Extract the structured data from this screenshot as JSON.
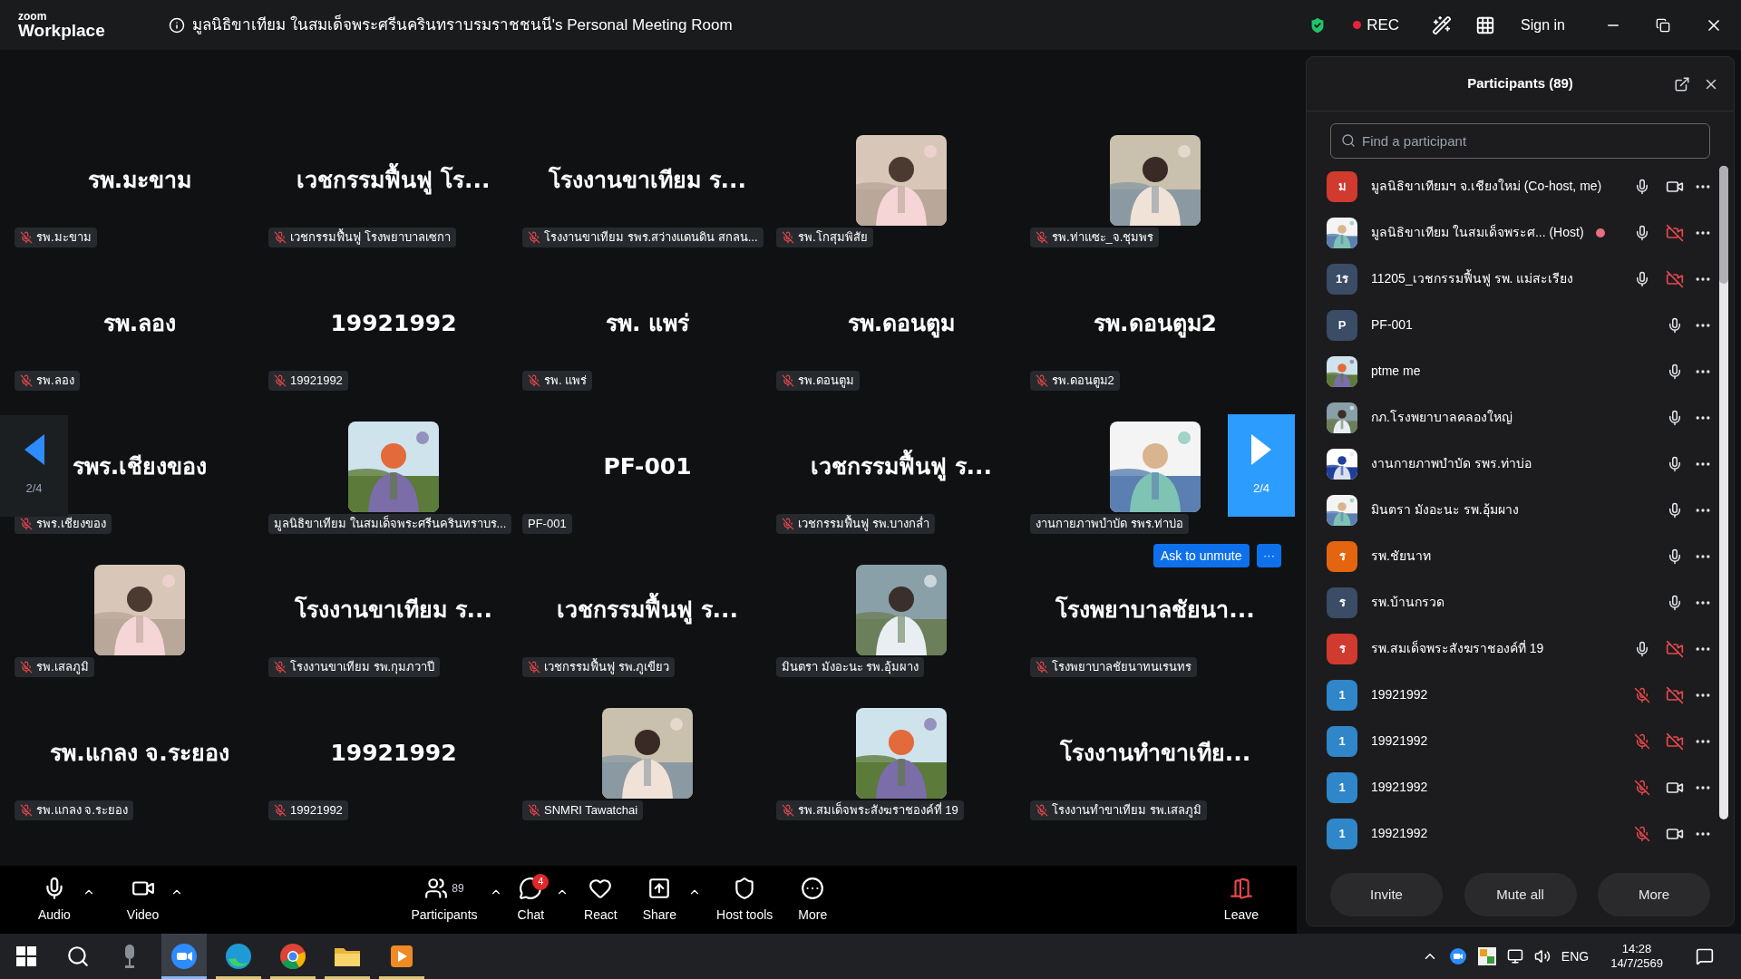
{
  "app": {
    "logo_top": "zoom",
    "logo_bottom": "Workplace"
  },
  "window": {
    "title": "มูลนิธิขาเทียม ในสมเด็จพระศรีนครินทราบรมราชชนนี's Personal Meeting Room",
    "recording": true,
    "rec_label": "REC",
    "sign_in": "Sign in"
  },
  "gallery": {
    "prev_page": "2/4",
    "next_page": "2/4",
    "ask_to_unmute": "Ask to unmute",
    "ask_more": "···",
    "tiles": [
      {
        "kind": "name",
        "display": "รพ.มะขาม",
        "label": "รพ.มะขาม",
        "muted": true
      },
      {
        "kind": "name",
        "display": "เวชกรรมฟื้นฟู โร...",
        "label": "เวชกรรมฟื้นฟู โรงพยาบาลเซกา",
        "muted": true
      },
      {
        "kind": "name",
        "display": "โรงงานขาเทียม ร...",
        "label": "โรงงานขาเทียม รพร.สว่างแดนดิน สกลน...",
        "muted": true
      },
      {
        "kind": "picture",
        "label": "รพ.โกสุมพิสัย",
        "muted": true
      },
      {
        "kind": "picture",
        "label": "รพ.ท่าแซะ_จ.ชุมพร",
        "muted": true
      },
      {
        "kind": "name",
        "display": "รพ.ลอง",
        "label": "รพ.ลอง",
        "muted": true
      },
      {
        "kind": "name",
        "display": "19921992",
        "label": "19921992",
        "muted": true
      },
      {
        "kind": "name",
        "display": "รพ. แพร่",
        "label": "รพ. แพร่",
        "muted": true
      },
      {
        "kind": "name",
        "display": "รพ.ดอนตูม",
        "label": "รพ.ดอนตูม",
        "muted": true
      },
      {
        "kind": "name",
        "display": "รพ.ดอนตูม2",
        "label": "รพ.ดอนตูม2",
        "muted": true
      },
      {
        "kind": "name",
        "display": "รพร.เชียงของ",
        "label": "รพร.เชียงของ",
        "muted": true
      },
      {
        "kind": "picture",
        "label": "มูลนิธิขาเทียม ในสมเด็จพระศรีนครินทราบร...",
        "muted": false
      },
      {
        "kind": "name",
        "display": "PF-001",
        "label": "PF-001",
        "muted": false
      },
      {
        "kind": "name",
        "display": "เวชกรรมฟื้นฟู ร...",
        "label": "เวชกรรมฟื้นฟู รพ.บางกล่ำ",
        "muted": true
      },
      {
        "kind": "picture",
        "label": "งานกายภาพบำบัด รพร.ท่าบ่อ",
        "muted": false
      },
      {
        "kind": "picture",
        "label": "รพ.เสลภูมิ",
        "muted": true
      },
      {
        "kind": "name",
        "display": "โรงงานขาเทียม ร...",
        "label": "โรงงานขาเทียม รพ.กุมภวาปี",
        "muted": true
      },
      {
        "kind": "name",
        "display": "เวชกรรมฟื้นฟู ร...",
        "label": "เวชกรรมฟื้นฟู รพ.ภูเขียว",
        "muted": true
      },
      {
        "kind": "picture",
        "label": "มินตรา มังอะนะ รพ.อุ้มผาง",
        "muted": false
      },
      {
        "kind": "name",
        "display": "โรงพยาบาลชัยนา...",
        "label": "โรงพยาบาลชัยนาทนเรนทร",
        "muted": true
      },
      {
        "kind": "name",
        "display": "รพ.แกลง จ.ระยอง",
        "label": "รพ.แกลง จ.ระยอง",
        "muted": true
      },
      {
        "kind": "name",
        "display": "19921992",
        "label": "19921992",
        "muted": true
      },
      {
        "kind": "picture",
        "label": "SNMRI Tawatchai",
        "muted": true
      },
      {
        "kind": "picture",
        "label": "รพ.สมเด็จพระสังฆราชองค์ที่ 19",
        "muted": true
      },
      {
        "kind": "name",
        "display": "โรงงานทำขาเทีย...",
        "label": "โรงงานทำขาเทียม รพ.เสลภูมิ",
        "muted": true
      }
    ]
  },
  "toolbar": {
    "left_items": [
      {
        "kind": "audio",
        "label": "Audio",
        "caret": true
      },
      {
        "kind": "video",
        "label": "Video",
        "caret": true
      }
    ],
    "center_items": [
      {
        "kind": "participants",
        "label": "Participants",
        "count": "89",
        "caret": true
      },
      {
        "kind": "chat",
        "label": "Chat",
        "badge": "4",
        "caret": true
      },
      {
        "kind": "react",
        "label": "React",
        "caret": false
      },
      {
        "kind": "share",
        "label": "Share",
        "caret": true
      },
      {
        "kind": "host",
        "label": "Host tools",
        "caret": false
      },
      {
        "kind": "more",
        "label": "More",
        "caret": false
      }
    ],
    "right_items": [
      {
        "kind": "leave",
        "label": "Leave",
        "caret": false
      }
    ]
  },
  "participants_panel": {
    "title": "Participants (89)",
    "search": {
      "placeholder": "Find a participant"
    },
    "participants": [
      {
        "kind": "letter",
        "initials": "ม",
        "color": "#d13a2e",
        "name": "มูลนิธิขาเทียมฯ จ.เชียงใหม่ (Co-host, me)",
        "recording": false,
        "muted": false,
        "camera_off": false
      },
      {
        "kind": "picture",
        "name": "มูลนิธิขาเทียม ในสมเด็จพระศ... (Host)",
        "recording": true,
        "muted": false,
        "camera_off": true
      },
      {
        "kind": "letter",
        "initials": "1ร",
        "color": "#3a4c66",
        "name": "11205_เวชกรรมฟื้นฟู รพ. แม่สะเรียง",
        "recording": false,
        "muted": false,
        "camera_off": true
      },
      {
        "kind": "letter",
        "initials": "P",
        "color": "#3a4c66",
        "name": "PF-001",
        "recording": false,
        "muted": false
      },
      {
        "kind": "picture",
        "name": "ptme me",
        "recording": false,
        "muted": false
      },
      {
        "kind": "picture",
        "name": "กภ.โรงพยาบาลคลองใหญ่",
        "recording": false,
        "muted": false
      },
      {
        "kind": "picture",
        "name": "งานกายภาพบำบัด รพร.ท่าบ่อ",
        "recording": false,
        "muted": false
      },
      {
        "kind": "picture",
        "name": "มินตรา มังอะนะ รพ.อุ้มผาง",
        "recording": false,
        "muted": false
      },
      {
        "kind": "letter",
        "initials": "ร",
        "color": "#e4650f",
        "name": "รพ.ชัยนาท",
        "recording": false,
        "muted": false
      },
      {
        "kind": "letter",
        "initials": "ร",
        "color": "#3a4c66",
        "name": "รพ.บ้านกรวด",
        "recording": false,
        "muted": false
      },
      {
        "kind": "letter",
        "initials": "ร",
        "color": "#d13a2e",
        "name": "รพ.สมเด็จพระสังฆราชองค์ที่ 19",
        "recording": false,
        "muted": false,
        "camera_off": true
      },
      {
        "kind": "letter",
        "initials": "1",
        "color": "#2f86c9",
        "name": "19921992",
        "recording": false,
        "muted": true,
        "camera_off": true
      },
      {
        "kind": "letter",
        "initials": "1",
        "color": "#2f86c9",
        "name": "19921992",
        "recording": false,
        "muted": true,
        "camera_off": true
      },
      {
        "kind": "letter",
        "initials": "1",
        "color": "#2f86c9",
        "name": "19921992",
        "recording": false,
        "muted": true,
        "camera_off": false
      },
      {
        "kind": "letter",
        "initials": "1",
        "color": "#2f86c9",
        "name": "19921992",
        "recording": false,
        "muted": true,
        "camera_off": false
      }
    ],
    "buttons": [
      "Invite",
      "Mute all",
      "More"
    ]
  },
  "taskbar": {
    "apps": [
      {
        "kind": "mic",
        "running": false,
        "active": false
      },
      {
        "kind": "zoom",
        "running": true,
        "active": true
      },
      {
        "kind": "edge",
        "running": true,
        "active": false
      },
      {
        "kind": "chrome",
        "running": true,
        "active": false
      },
      {
        "kind": "folder",
        "running": true,
        "active": false
      },
      {
        "kind": "player",
        "running": true,
        "active": false
      }
    ],
    "language": "ENG",
    "time": "14:28",
    "date": "14/7/2569"
  }
}
